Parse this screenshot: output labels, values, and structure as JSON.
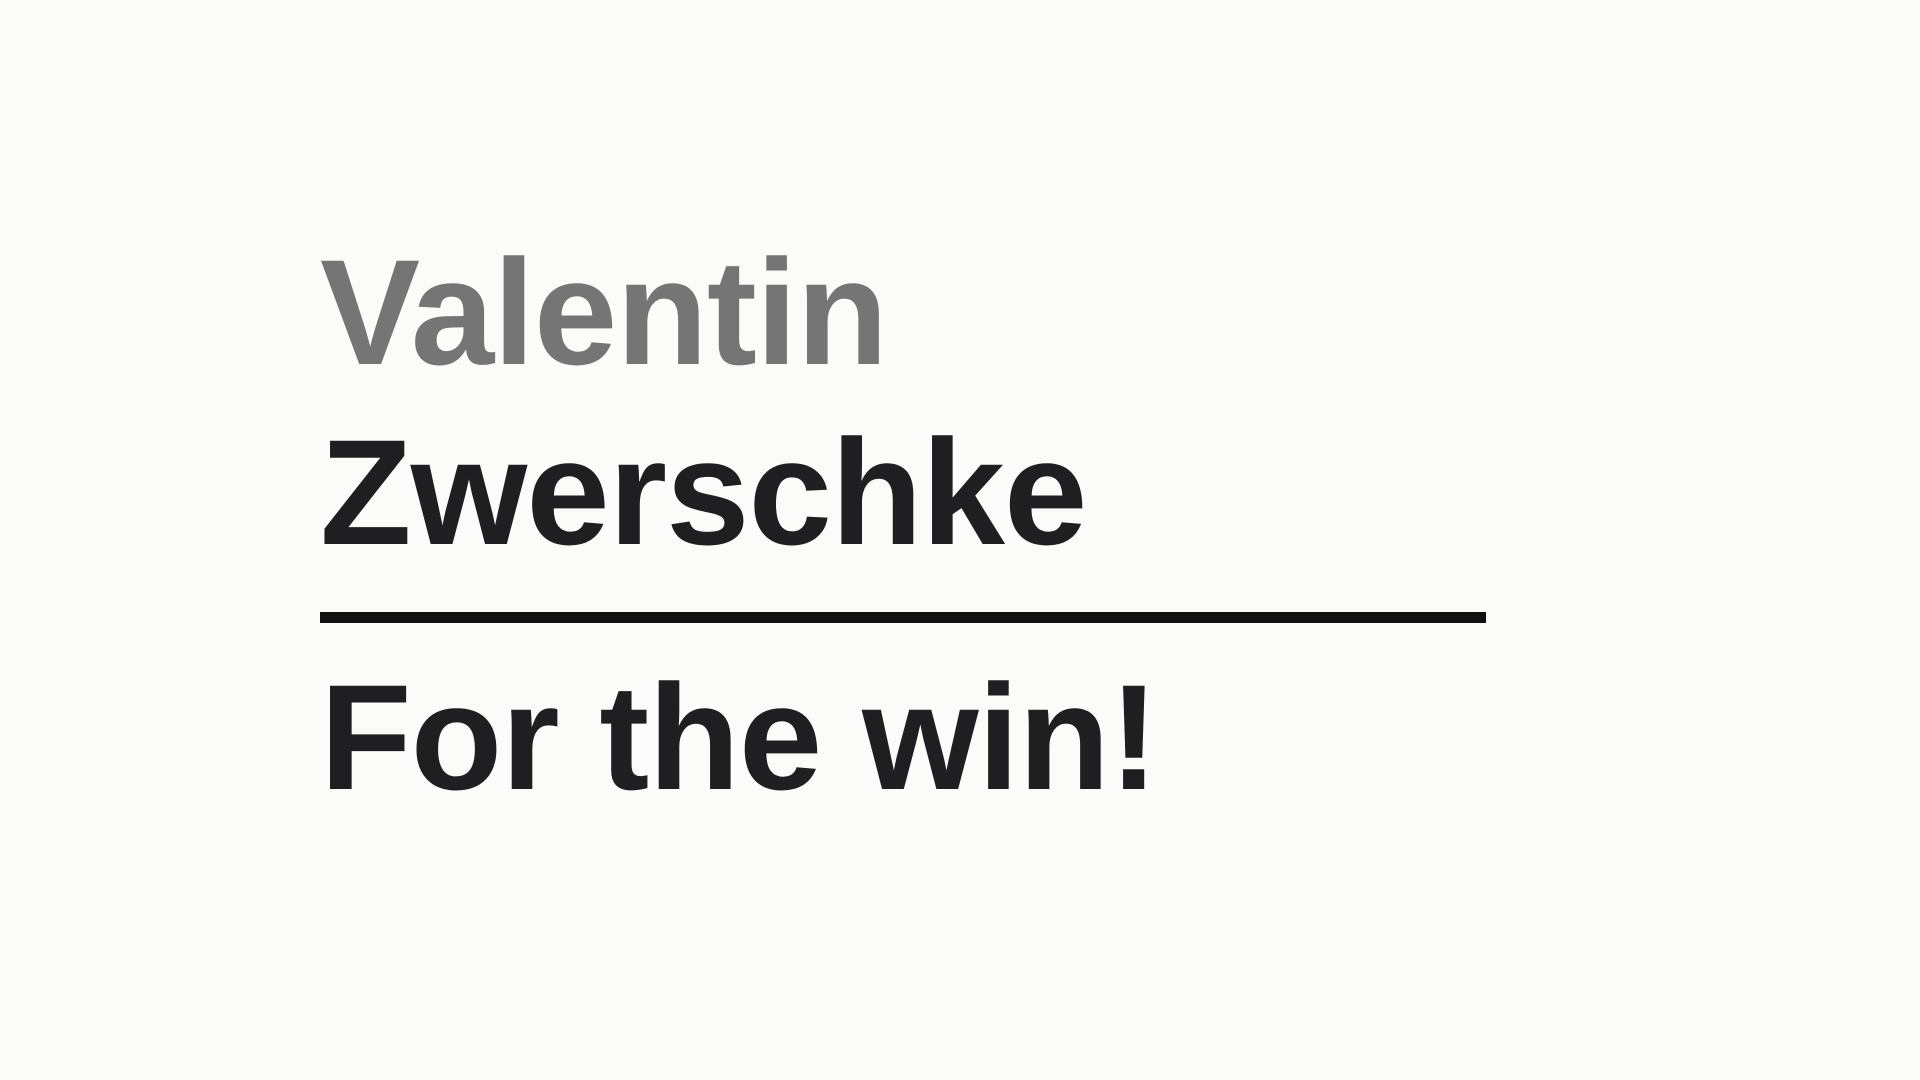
{
  "title_block": {
    "first_name": "Valentin",
    "last_name": "Zwerschke",
    "tagline": "For the win!"
  },
  "colors": {
    "background": "#fbfbfa",
    "first_name": "#757575",
    "last_name": "#1f1f21",
    "rule": "#111111",
    "tagline": "#1f1f21"
  }
}
